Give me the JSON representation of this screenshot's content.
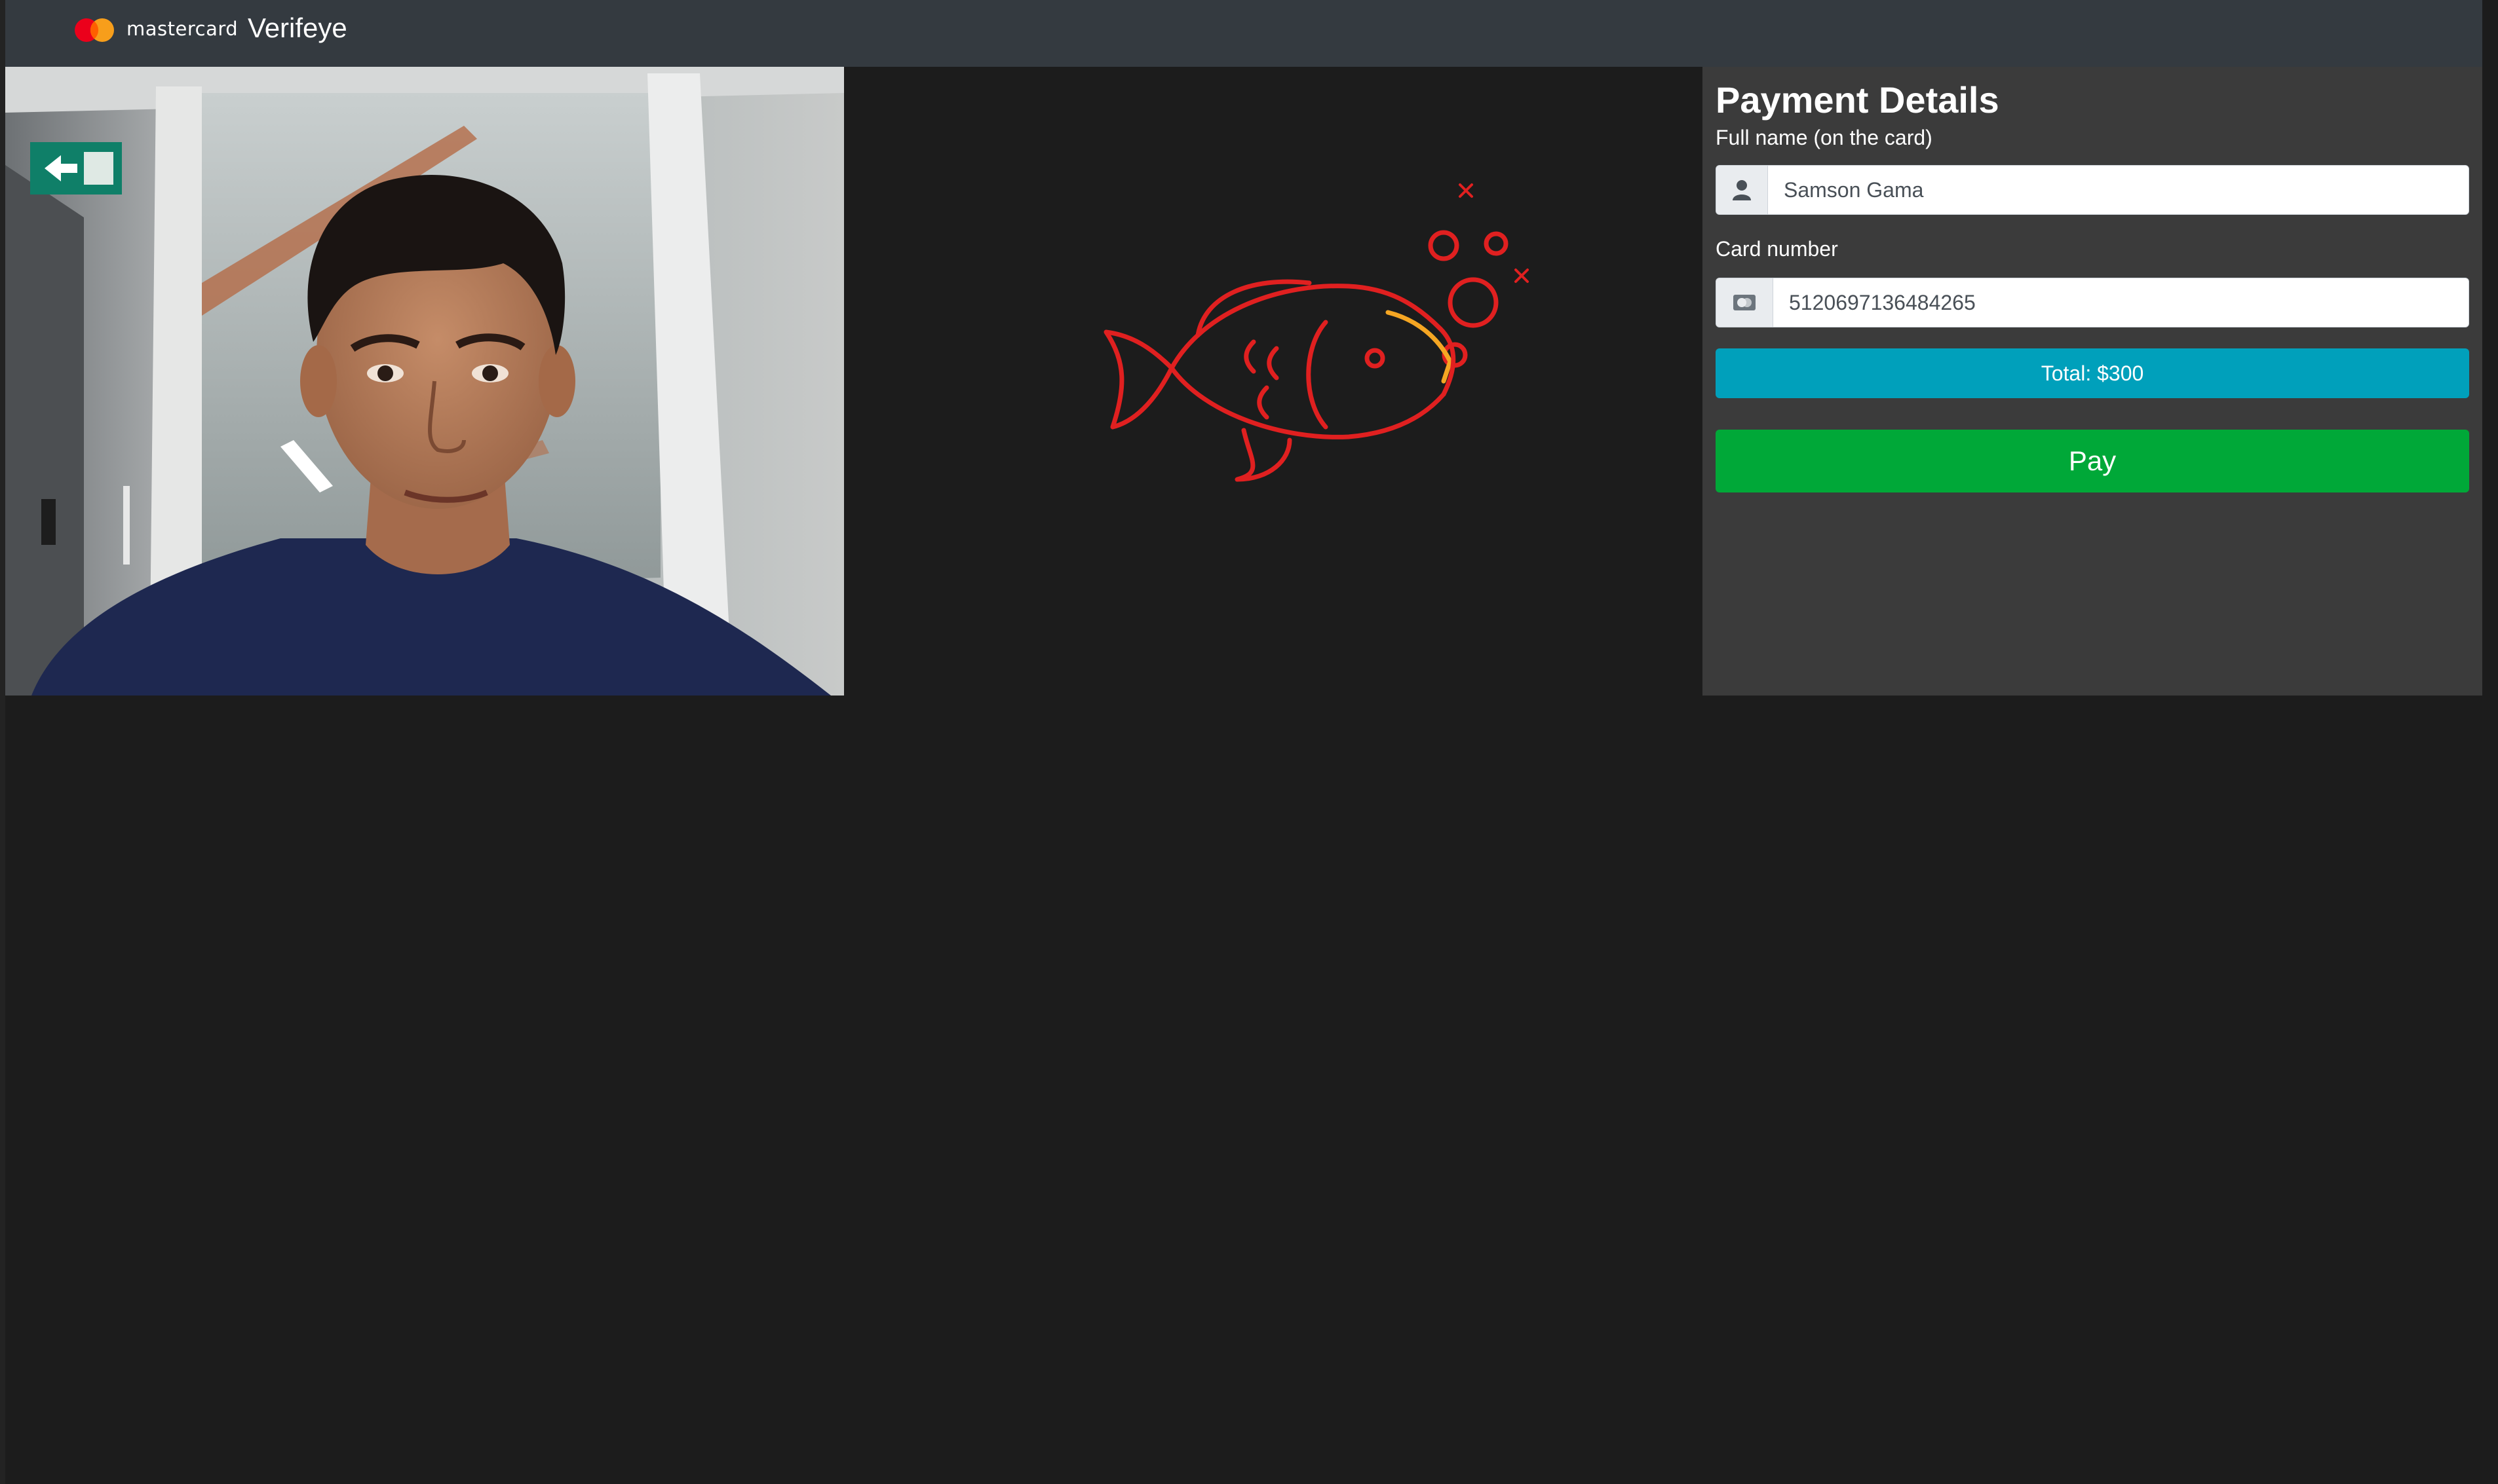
{
  "header": {
    "logo_word": "mastercard",
    "app_name": "Verifeye"
  },
  "camera": {
    "exit_sign_icon": "exit-sign-icon"
  },
  "animation": {
    "icon": "fish-icon",
    "color": "#e02020",
    "accent": "#f5a623"
  },
  "payment": {
    "title": "Payment Details",
    "name_label": "Full name (on the card)",
    "name_value": "Samson Gama",
    "card_label": "Card number",
    "card_value": "5120697136484265",
    "total_label": "Total: $300",
    "pay_label": "Pay"
  },
  "colors": {
    "topbar": "#343a40",
    "panel": "#3b3b3b",
    "total": "#00a0bb",
    "pay": "#00a838",
    "background": "#1c1c1c"
  }
}
